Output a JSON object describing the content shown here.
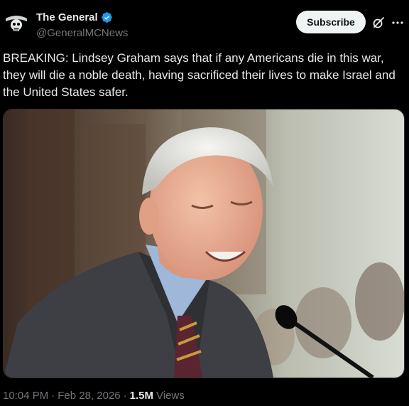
{
  "author": {
    "display_name": "The General",
    "handle": "@GeneralMCNews",
    "verified": true,
    "badge_color": "#1d9bf0"
  },
  "actions": {
    "subscribe_label": "Subscribe",
    "grok_icon": "grok-icon",
    "more_icon": "more-icon"
  },
  "tweet": {
    "text": "BREAKING: Lindsey Graham says that if any Americans die in this war, they will die a noble death, having sacrificed their lives to make Israel and the United States safer."
  },
  "meta": {
    "time": "10:04 PM",
    "separator": "·",
    "date": "Feb 28, 2026",
    "views_count": "1.5M",
    "views_label": "Views"
  },
  "colors": {
    "background": "#000000",
    "text": "#e7e9ea",
    "secondary": "#71767b"
  }
}
